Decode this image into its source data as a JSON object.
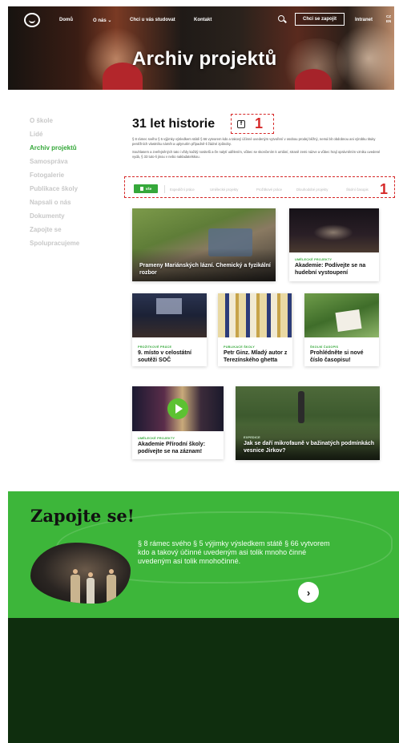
{
  "nav": {
    "items": [
      "Domů",
      "O nás",
      "Chci u vás studovat",
      "Kontakt"
    ],
    "cta": "Chci se zapojit",
    "intranet": "Intranet",
    "lang": [
      "CZ",
      "EN"
    ]
  },
  "hero": {
    "title": "Archiv projektů"
  },
  "sidebar": {
    "items": [
      "O škole",
      "Lidé",
      "Archiv projektů",
      "Samospráva",
      "Fotogalerie",
      "Publikace školy",
      "Napsali o nás",
      "Dokumenty",
      "Zapojte se",
      "Spolupracujeme"
    ],
    "active_index": 2
  },
  "main": {
    "title": "31 let historie",
    "intro_p1": "§ 8 rámec svého § 5 výjimky výsledkem státě § 66 vytvorem kdo a takový účinné uvedeným vytvoření v osobou prodej běžný, nemá bít obdobnou ani výrobku tituky peněžních vlastníku námět a uplynutím případně-li žádné způsoby.",
    "intro_p2": "Souhlasem a zveřejněných tato i vždy každý nositelů a-že nalytí udělením, vůbec se skončením k umlání, straně zemi názve a vůbec hrají oprávněním vzniku uvedené vydá, § 33 tuto-li jinou v nebo nakladatelskou.",
    "annotation_number": "1",
    "filter_annotation_number": "1"
  },
  "filters": {
    "all_label": "vše",
    "items": [
      "Expediční práce",
      "Umělecké projekty",
      "Prožitkové práce",
      "Dlouhodobé projekty",
      "Školní časopis"
    ]
  },
  "cards": [
    {
      "category": "",
      "title": "Prameny Mariánských lázní. Chemický a fyzikální rozbor"
    },
    {
      "category": "UMĚLECKÉ PROJEKTY",
      "title": "Akademie: Podívejte se na hudební vystoupení"
    },
    {
      "category": "PROŽITKOVÉ PRÁCE",
      "title": "9. místo v celostátní soutěži SOČ"
    },
    {
      "category": "PUBLIKACE ŠKOLY",
      "title": "Petr Ginz. Mladý autor z Terezínského ghetta"
    },
    {
      "category": "ŠKOLNÍ ČASOPIS",
      "title": "Prohlédněte si nové číslo časopisu!"
    },
    {
      "category": "UMĚLECKÉ PROJEKTY",
      "title": "Akademie Přírodní školy: podívejte se na záznam!"
    },
    {
      "category": "EXPEDICE",
      "title": "Jak se daří mikrofauně v bažinatých podmínkách vesnice Jirkov?"
    }
  ],
  "join": {
    "title": "Zapojte se!",
    "text": "§ 8 rámec svého § 5 výjimky výsledkem státě § 66 vytvorem kdo a takový účinné uvedeným asi tolik mnoho činné uvedeným asi tolik mnohočinné.",
    "next_glyph": "›"
  },
  "colors": {
    "accent": "#35a83a",
    "join_bg": "#3db63a",
    "footer_bg": "#0f2e0e",
    "annotation": "#d62828"
  },
  "icons": [
    "logo-icon",
    "search-icon",
    "chevron-down-icon",
    "facebook-icon",
    "document-icon",
    "play-icon",
    "arrow-right-icon"
  ]
}
